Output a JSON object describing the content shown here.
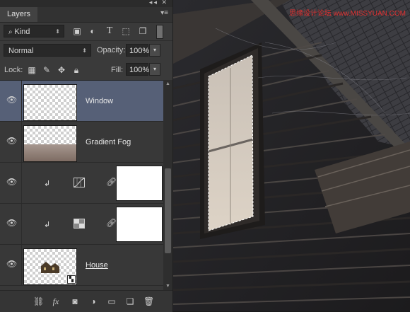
{
  "panel": {
    "tab_label": "Layers",
    "menu_icon": "panel-menu-icon",
    "filter": {
      "kind_label": "Kind",
      "icons": [
        "image-filter-icon",
        "adjustment-filter-icon",
        "type-filter-icon",
        "shape-filter-icon",
        "smart-object-filter-icon"
      ]
    },
    "blend": {
      "mode": "Normal",
      "opacity_label": "Opacity:",
      "opacity_value": "100%"
    },
    "lock": {
      "label": "Lock:",
      "icons": [
        "lock-transparent-icon",
        "lock-image-icon",
        "lock-position-icon",
        "lock-all-icon"
      ],
      "fill_label": "Fill:",
      "fill_value": "100%"
    },
    "layers": [
      {
        "name": "Window",
        "selected": true,
        "type": "pixel"
      },
      {
        "name": "Gradient Fog",
        "selected": false,
        "type": "pixel"
      },
      {
        "name": "",
        "selected": false,
        "type": "adjustment-curves"
      },
      {
        "name": "",
        "selected": false,
        "type": "adjustment-levels"
      },
      {
        "name": "House",
        "selected": false,
        "type": "smart-object"
      }
    ],
    "bottom_icons": [
      "link-layers-icon",
      "fx-icon",
      "add-mask-icon",
      "new-adjustment-icon",
      "new-group-icon",
      "new-layer-icon",
      "delete-layer-icon"
    ]
  },
  "watermark": "思缘设计论坛 www.MISSYUAN.COM",
  "colors": {
    "panel_bg": "#3a3a3a",
    "selected_row": "#566077",
    "accent_watermark": "#e03030"
  }
}
